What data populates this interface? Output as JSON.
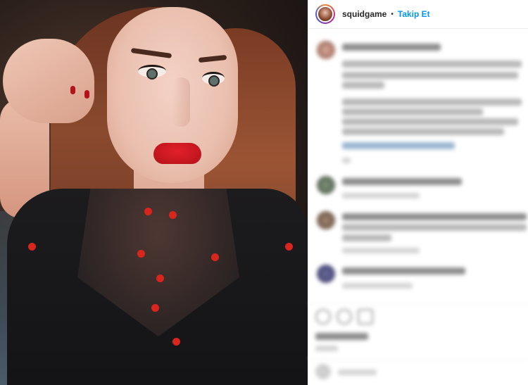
{
  "post": {
    "username": "squidgame",
    "separator": "•",
    "follow_label": "Takip Et"
  },
  "colors": {
    "follow_blue": "#0095f6",
    "lipstick_red": "#d8261e"
  },
  "icons": [
    "avatar-ring",
    "like-icon",
    "comment-icon",
    "share-icon"
  ]
}
